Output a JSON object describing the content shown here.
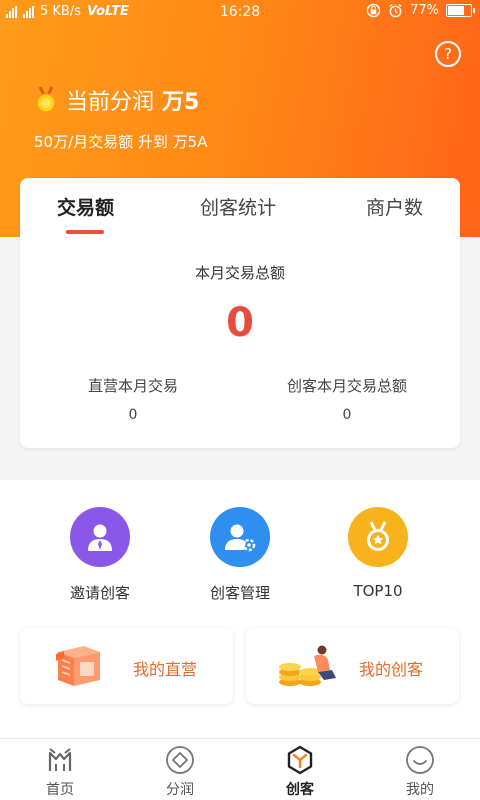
{
  "status_bar": {
    "network_speed": "5 KB/s",
    "volte": "VoLTE",
    "time": "16:28",
    "battery": "77%",
    "battery_level": 0.77
  },
  "header": {
    "level_label": "当前分润",
    "level_value": "万5",
    "upgrade_text": "50万/月交易额 升到 万5A",
    "help_icon": "?"
  },
  "stats_card": {
    "tabs": [
      {
        "label": "交易额",
        "active": true
      },
      {
        "label": "创客统计",
        "active": false
      },
      {
        "label": "商户数",
        "active": false
      }
    ],
    "total_label": "本月交易总额",
    "total_value": "0",
    "direct_label": "直营本月交易",
    "direct_value": "0",
    "maker_label": "创客本月交易总额",
    "maker_value": "0"
  },
  "entries": [
    {
      "label": "邀请创客",
      "icon": "invite-user-icon",
      "color": "#8b57e8"
    },
    {
      "label": "创客管理",
      "icon": "user-manage-icon",
      "color": "#2f8ff0"
    },
    {
      "label": "TOP10",
      "icon": "medal-star-icon",
      "color": "#f7b31c"
    }
  ],
  "tiles": [
    {
      "label": "我的直营",
      "icon": "store-icon"
    },
    {
      "label": "我的创客",
      "icon": "coins-person-icon"
    }
  ],
  "tabbar": [
    {
      "label": "首页",
      "icon": "home-icon",
      "active": false
    },
    {
      "label": "分润",
      "icon": "diamond-icon",
      "active": false
    },
    {
      "label": "创客",
      "icon": "maker-hexagon-icon",
      "active": true
    },
    {
      "label": "我的",
      "icon": "smile-icon",
      "active": false
    }
  ],
  "colors": {
    "accent": "#ff8a16",
    "indicator": "#e8503a",
    "highlight_value": "#e84b3c",
    "tile_text": "#e86b24"
  }
}
